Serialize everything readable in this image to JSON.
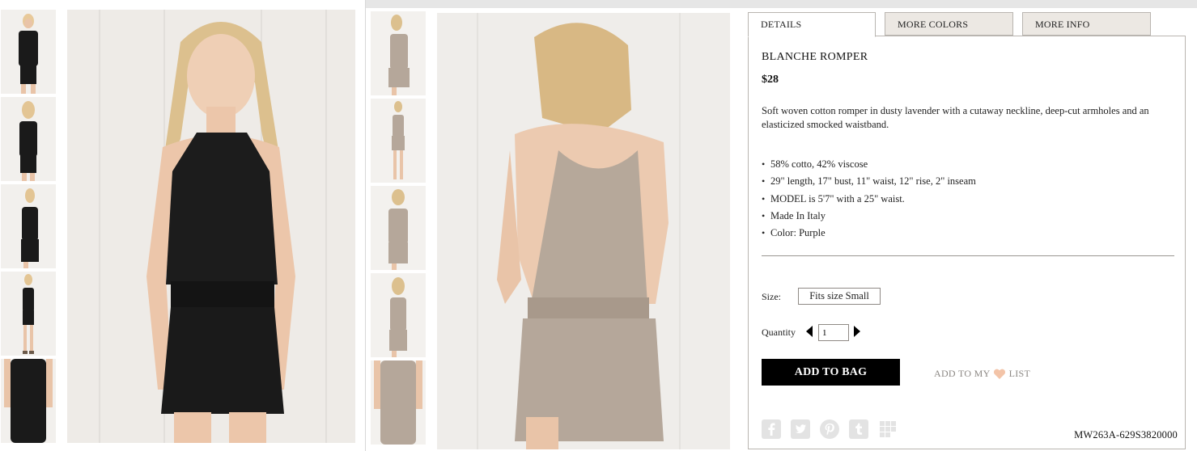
{
  "tabs": [
    {
      "label": "DETAILS",
      "active": true
    },
    {
      "label": "MORE COLORS",
      "active": false
    },
    {
      "label": "MORE INFO",
      "active": false
    }
  ],
  "product": {
    "title": "BLANCHE ROMPER",
    "price": "$28",
    "description": "Soft woven cotton romper in dusty lavender with a cutaway neckline, deep-cut armholes and an elasticized smocked waistband.",
    "features": [
      "58% cotto, 42% viscose",
      "29\" length, 17\" bust, 11\" waist, 12\" rise, 2\" inseam",
      "MODEL is 5'7\" with a 25\" waist.",
      "Made In Italy",
      "Color: Purple"
    ],
    "sku": "MW263A-629S3820000"
  },
  "size": {
    "label": "Size:",
    "selected": "Fits size Small"
  },
  "quantity": {
    "label": "Quantity",
    "value": "1"
  },
  "actions": {
    "add_to_bag": "ADD TO BAG",
    "add_to_list_prefix": "ADD TO MY",
    "add_to_list_suffix": "LIST"
  },
  "icons": {
    "heart": "heart-icon",
    "social": [
      "facebook-icon",
      "twitter-icon",
      "pinterest-icon",
      "tumblr-icon",
      "more-share-icon"
    ]
  },
  "colors": {
    "black_romper": "#1a1a1a",
    "mauve_romper": "#b5a79a",
    "heart": "#f3c4a8",
    "social_grey": "#e3e3e3",
    "tab_inactive": "#ece8e3"
  },
  "images": {
    "left_thumbnails": 5,
    "right_thumbnails": 5
  }
}
